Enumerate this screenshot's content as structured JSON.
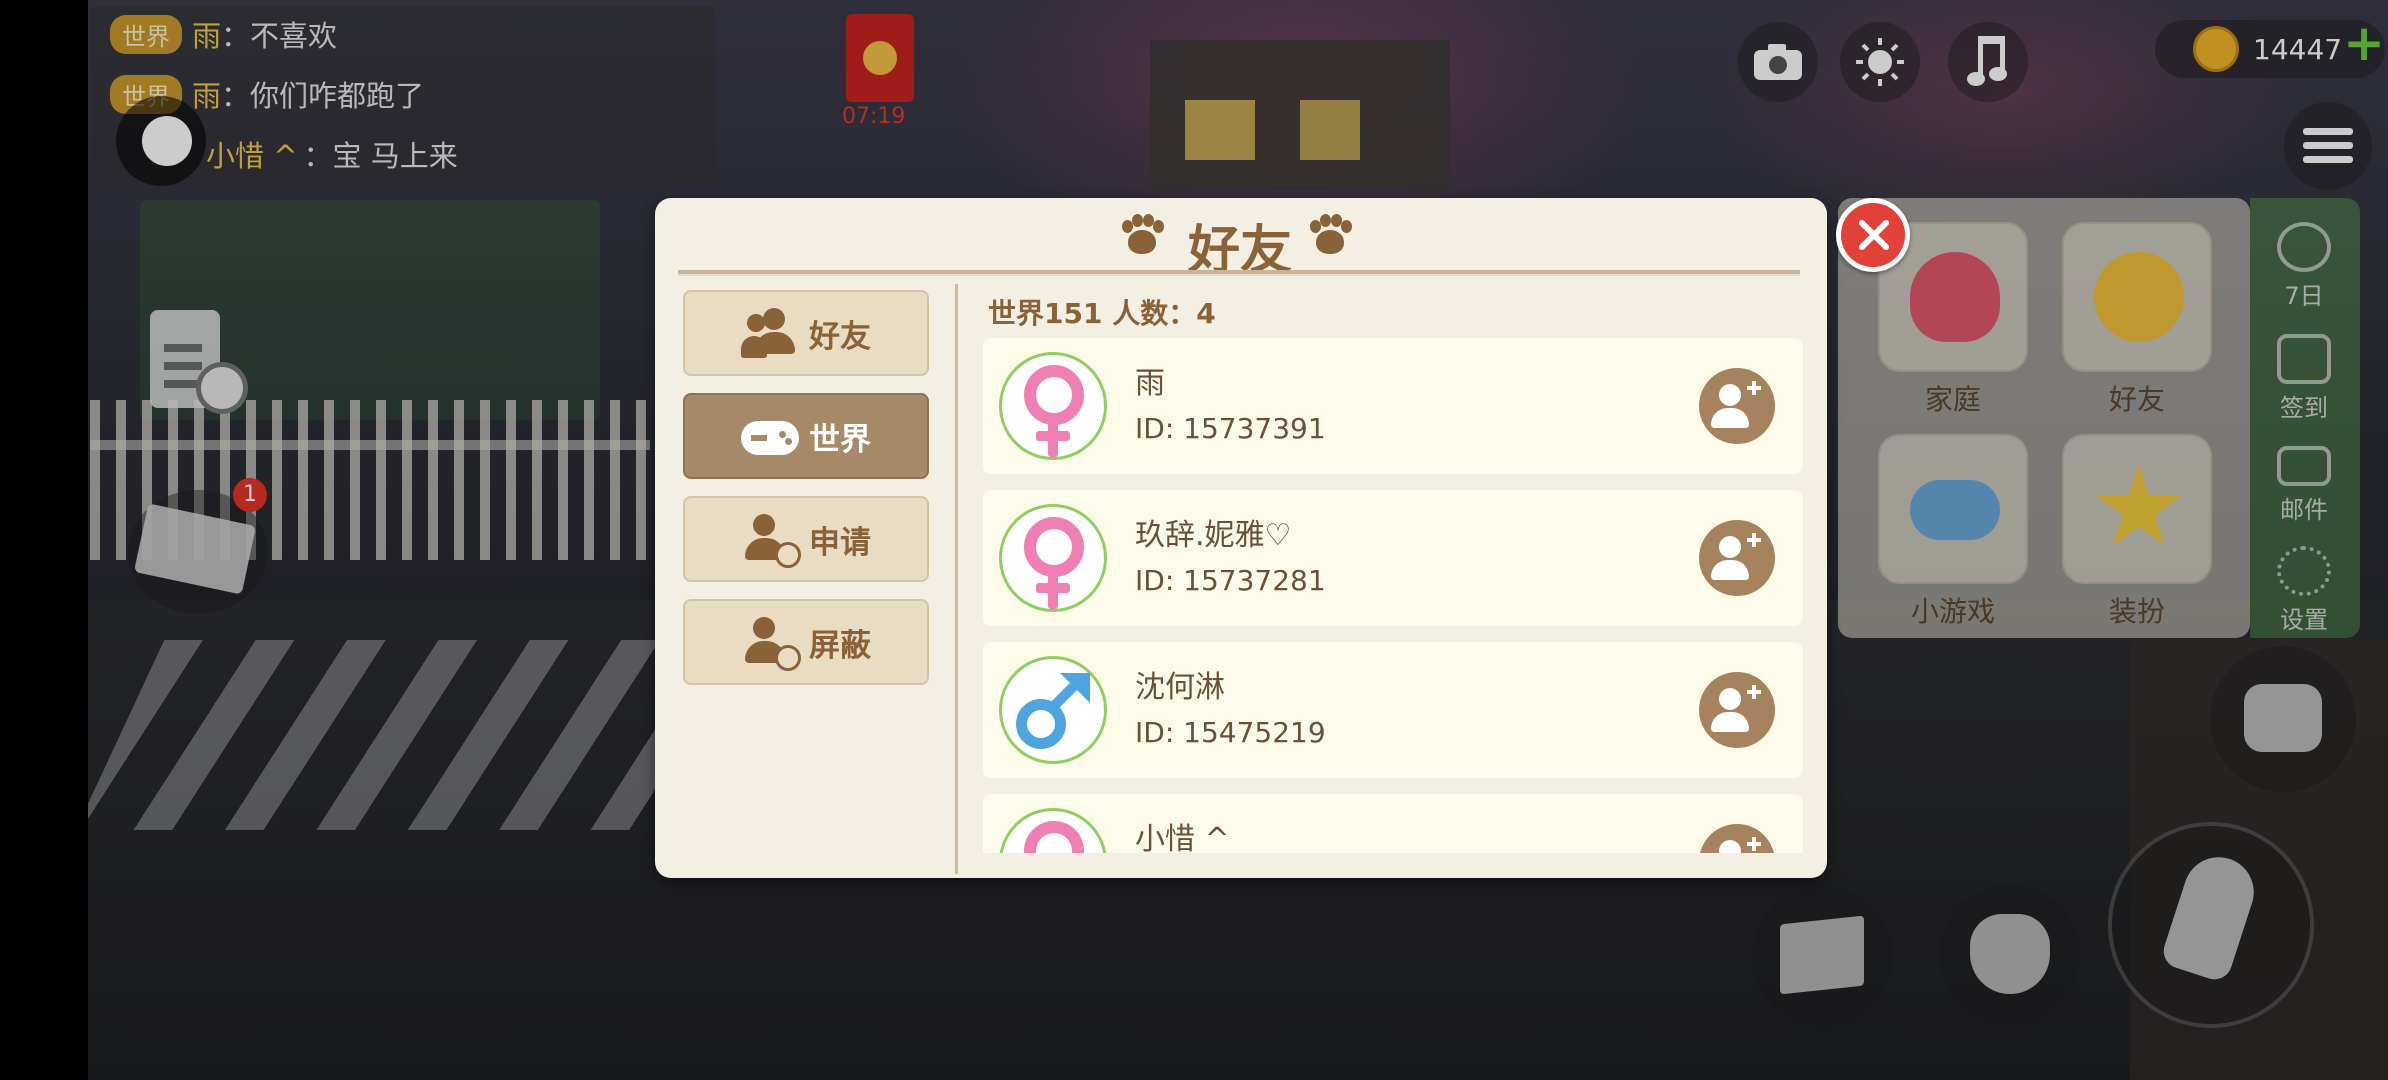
{
  "chat": {
    "messages": [
      {
        "channel": "世界",
        "name": "雨",
        "text": "：不喜欢"
      },
      {
        "channel": "世界",
        "name": "雨",
        "text": "：你们咋都跑了"
      },
      {
        "channel": "",
        "name": "小惜 ^",
        "text": "：宝 马上来"
      }
    ]
  },
  "hud": {
    "redpack_time": "07:19",
    "coins": "14447",
    "coin_add": "+"
  },
  "notification_badge": "1",
  "menu": {
    "tiles": [
      {
        "label": "家庭",
        "icon": "heart-icon",
        "color": "#e0586a"
      },
      {
        "label": "好友",
        "icon": "friends-icon",
        "color": "#f0c03a"
      },
      {
        "label": "小游戏",
        "icon": "gamepad-icon",
        "color": "#6aa8d8"
      },
      {
        "label": "装扮",
        "icon": "magic-wand-icon",
        "color": "#f0c83a"
      }
    ],
    "strip": [
      {
        "label": "7日",
        "icon": "seven-day-icon"
      },
      {
        "label": "签到",
        "icon": "checkin-icon"
      },
      {
        "label": "邮件",
        "icon": "mail-icon"
      },
      {
        "label": "设置",
        "icon": "gear-icon"
      }
    ]
  },
  "dialog": {
    "title": "好友",
    "tabs": [
      {
        "label": "好友",
        "icon": "friends-icon"
      },
      {
        "label": "世界",
        "icon": "gamepad-icon"
      },
      {
        "label": "申请",
        "icon": "friend-request-icon"
      },
      {
        "label": "屏蔽",
        "icon": "block-user-icon"
      }
    ],
    "active_tab": "世界",
    "list_header": "世界151  人数：4",
    "players": [
      {
        "name": "雨",
        "id": "ID: 15737391",
        "gender": "female"
      },
      {
        "name": "玖辞.妮雅♡",
        "id": "ID: 15737281",
        "gender": "female"
      },
      {
        "name": "沈何淋",
        "id": "ID: 15475219",
        "gender": "male"
      },
      {
        "name": "小惜 ^",
        "id": "",
        "gender": "female"
      }
    ]
  }
}
